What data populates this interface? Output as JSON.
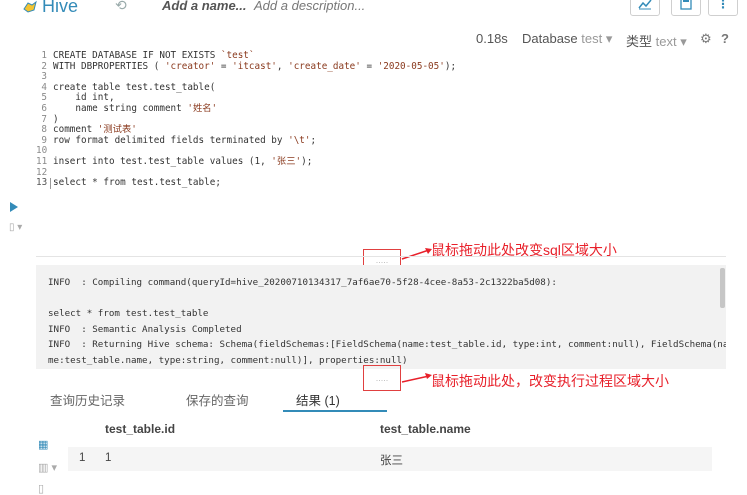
{
  "header": {
    "app_name": "Hive",
    "name_placeholder": "Add a name...",
    "description_placeholder": "Add a description..."
  },
  "editor": {
    "exec_time": "0.18s",
    "database_label": "Database",
    "database_value": "test",
    "type_label": "类型",
    "type_value": "text",
    "help": "?",
    "lines": [
      {
        "n": "1",
        "t": "CREATE DATABASE IF NOT EXISTS `test`"
      },
      {
        "n": "2",
        "t": "WITH DBPROPERTIES ( 'creator' = 'itcast', 'create_date' = '2020-05-05');"
      },
      {
        "n": "3",
        "t": ""
      },
      {
        "n": "4",
        "t": "create table test.test_table("
      },
      {
        "n": "5",
        "t": "    id int,"
      },
      {
        "n": "6",
        "t": "    name string comment '姓名'"
      },
      {
        "n": "7",
        "t": ")"
      },
      {
        "n": "8",
        "t": "comment '测试表'"
      },
      {
        "n": "9",
        "t": "row format delimited fields terminated by '\\t';"
      },
      {
        "n": "10",
        "t": ""
      },
      {
        "n": "11",
        "t": "insert into test.test_table values (1, '张三');"
      },
      {
        "n": "12",
        "t": ""
      },
      {
        "n": "13",
        "t": "select * from test.test_table;"
      }
    ]
  },
  "annotations": {
    "editor_resize": "鼠标拖动此处改变sql区域大小",
    "log_resize": "鼠标拖动此处，改变执行过程区域大小",
    "handle_dots": "....."
  },
  "log": {
    "lines": [
      "INFO  : Compiling command(queryId=hive_20200710134317_7af6ae70-5f28-4cee-8a53-2c1322ba5d08):",
      "",
      "select * from test.test_table",
      "INFO  : Semantic Analysis Completed",
      "INFO  : Returning Hive schema: Schema(fieldSchemas:[FieldSchema(name:test_table.id, type:int, comment:null), FieldSchema(na",
      "me:test_table.name, type:string, comment:null)], properties:null)"
    ]
  },
  "tabs": [
    {
      "label": "查询历史记录",
      "active": false
    },
    {
      "label": "保存的查询",
      "active": false
    },
    {
      "label": "结果 (1)",
      "active": true
    }
  ],
  "results": {
    "columns": [
      "test_table.id",
      "test_table.name"
    ],
    "rows": [
      {
        "index": "1",
        "id": "1",
        "name": "张三"
      }
    ]
  },
  "colors": {
    "accent": "#338bb8",
    "annotation": "#e8202a"
  }
}
